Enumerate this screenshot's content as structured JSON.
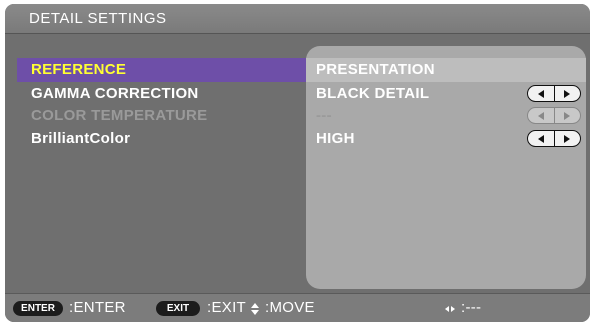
{
  "title": "DETAIL SETTINGS",
  "rows": [
    {
      "label": "REFERENCE",
      "value": "PRESENTATION",
      "state": "selected",
      "has_arrows": false
    },
    {
      "label": "GAMMA CORRECTION",
      "value": "BLACK DETAIL",
      "state": "normal",
      "has_arrows": true
    },
    {
      "label": "COLOR TEMPERATURE",
      "value": "---",
      "state": "disabled",
      "has_arrows": true
    },
    {
      "label": "BrilliantColor",
      "value": "HIGH",
      "state": "normal",
      "has_arrows": true
    }
  ],
  "footer": {
    "enter_key": "ENTER",
    "enter_label": ":ENTER",
    "exit_key": "EXIT",
    "exit_label": ":EXIT",
    "move_label": ":MOVE",
    "lr_label": ":---"
  },
  "colors": {
    "selected_label": "#ffff33",
    "selected_row_left": "#6e4fa8",
    "panel_background": "#6f6f6f",
    "value_panel": "#a9a9a9"
  }
}
